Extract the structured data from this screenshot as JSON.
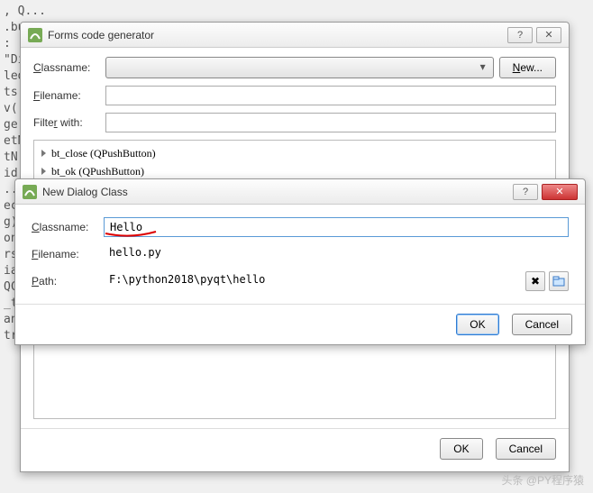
{
  "background_code": [
    ", Q...",
    ".bu...",
    "",
    ":",
    "\"Di...",
    "led...",
    "ts(...",
    "v(...",
    "ge...",
    "etN...",
    "tN...",
    "id...",
    "...",
    "ec...",
    "",
    "g)",
    "on...",
    "rs...",
    "",
    "ialo...",
    "QCo...",
    "_tr...",
    "ans...",
    "  tronclote(\"Dialom\" \"关闭\")"
  ],
  "parent": {
    "title": "Forms code generator",
    "help_glyph": "?",
    "close_glyph": "✕",
    "labels": {
      "classname": "Classname:",
      "filename": "Filename:",
      "filter": "Filter with:"
    },
    "new_button": "New...",
    "list": [
      "bt_close (QPushButton)",
      "bt_ok (QPushButton)"
    ],
    "footer": {
      "ok": "OK",
      "cancel": "Cancel"
    }
  },
  "dialog": {
    "title": "New Dialog Class",
    "help_glyph": "?",
    "close_glyph": "✕",
    "labels": {
      "classname": "Classname:",
      "filename": "Filename:",
      "path": "Path:"
    },
    "values": {
      "classname": "Hello",
      "filename": "hello.py",
      "path": "F:\\python2018\\pyqt\\hello"
    },
    "footer": {
      "ok": "OK",
      "cancel": "Cancel"
    }
  },
  "watermark": "头条 @PY程序猿"
}
